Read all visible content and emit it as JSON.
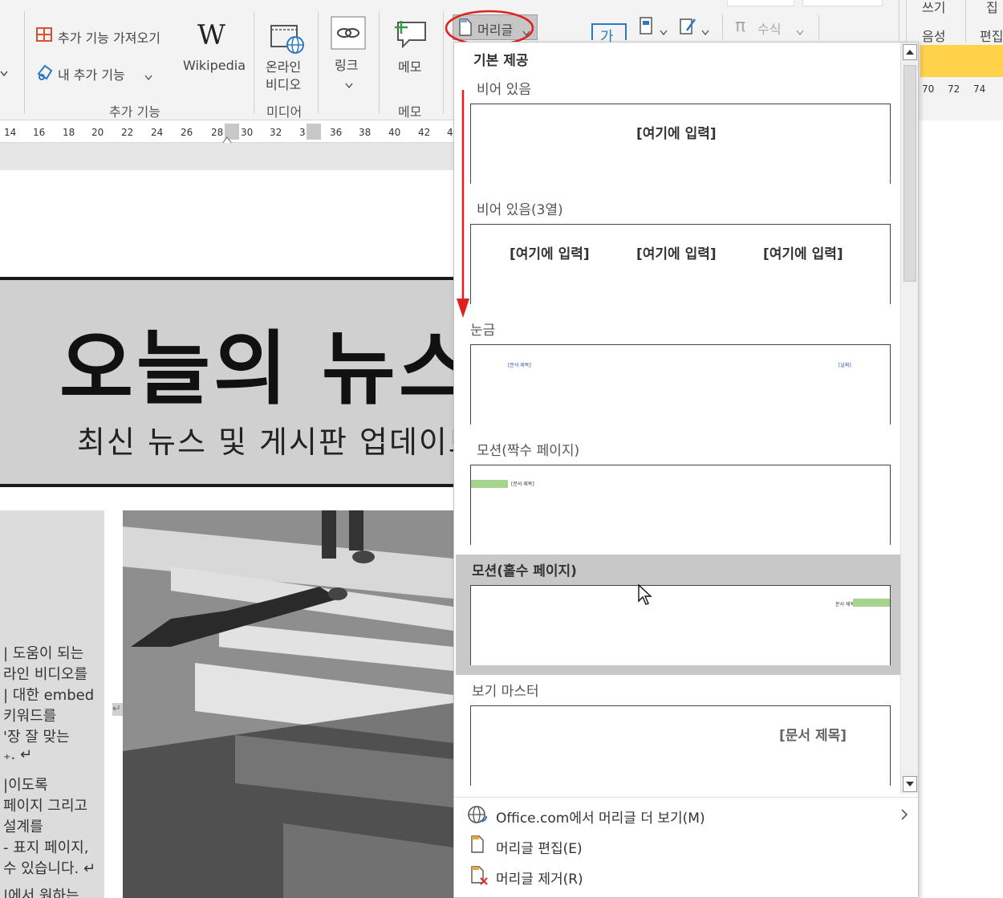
{
  "ribbon": {
    "addins": {
      "get_addins": "추가 기능 가져오기",
      "my_addins": "내 추가 기능",
      "group_label": "추가 기능",
      "wikipedia_logo": "W",
      "wikipedia_label": "Wikipedia"
    },
    "media": {
      "online_video": [
        "온라인",
        "비디오"
      ],
      "group_label": "미디어"
    },
    "links": {
      "link_label": "링크"
    },
    "comments": {
      "memo_label": "메모",
      "group_label": "메모"
    },
    "header_footer": {
      "header_button": "머리글"
    },
    "text": {
      "text_box_glyph": "가"
    },
    "symbols": {
      "equation": "수식"
    }
  },
  "right_pane": {
    "tab1": "쓰기",
    "tab2": "집",
    "voice": "음성",
    "edit": "편집",
    "ruler_nums": [
      "70",
      "72",
      "74"
    ]
  },
  "ruler": {
    "numbers": [
      "14",
      "16",
      "18",
      "20",
      "22",
      "24",
      "26",
      "28",
      "30",
      "32",
      "3",
      "36",
      "38",
      "40",
      "42",
      "4"
    ]
  },
  "document": {
    "title": "오늘의 뉴스",
    "subtitle": "최신 뉴스 및 게시판 업데이트",
    "side_text": [
      "| 도움이 되는",
      "라인 비디오를",
      "| 대한 embed",
      "키워드를",
      "'장 잘 맞는",
      "₊. ↵",
      "|이도록",
      "페이지 그리고",
      "설계를",
      "- 표지 페이지,",
      "수 있습니다. ↵",
      "|에서 원하는"
    ]
  },
  "dropdown": {
    "section_title": "기본 제공",
    "items": [
      {
        "label": "비어 있음",
        "placeholders": [
          "[여기에 입력]"
        ]
      },
      {
        "label": "비어 있음(3열)",
        "placeholders": [
          "[여기에 입력]",
          "[여기에 입력]",
          "[여기에 입력]"
        ]
      },
      {
        "label": "눈금",
        "placeholders": [
          "[문서 제목]",
          "[날짜]"
        ]
      },
      {
        "label": "모션(짝수 페이지)",
        "placeholders": [
          "[문서 제목]"
        ]
      },
      {
        "label": "모션(홀수 페이지)",
        "placeholders": [
          "문서 제목"
        ]
      },
      {
        "label": "보기 마스터",
        "placeholders": [
          "[문서 제목]"
        ]
      }
    ],
    "menu": {
      "more": "Office.com에서 머리글 더 보기(M)",
      "edit": "머리글 편집(E)",
      "remove": "머리글 제거(R)"
    }
  },
  "colors": {
    "accent_red": "#e0201c",
    "motion_green": "#a6d38d",
    "hover_gray": "#c8c8c8",
    "right_pane_yellow": "#ffd24a",
    "ribbon_bg": "#f3f3f3"
  }
}
